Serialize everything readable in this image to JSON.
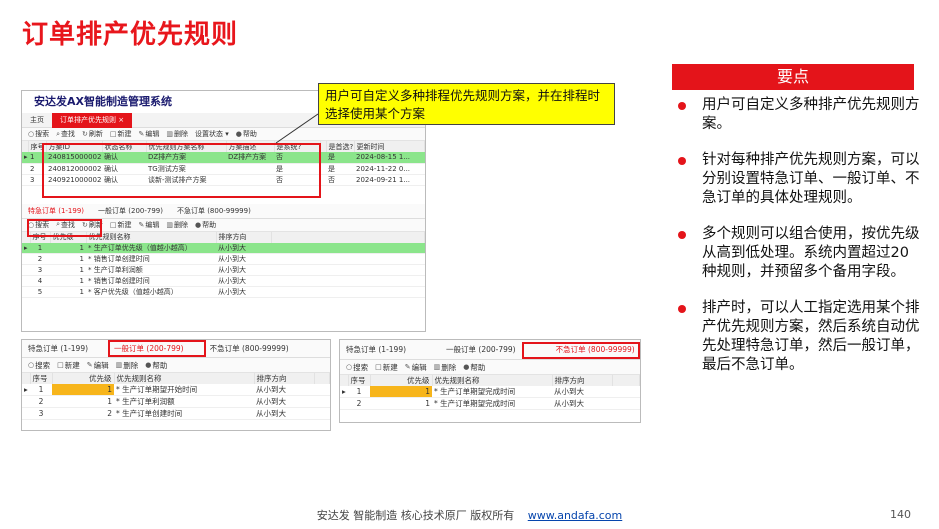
{
  "slide": {
    "title": "订单排产优先规则",
    "key_points_header": "要点",
    "key_points": [
      "用户可自定义多种排产优先规则方案。",
      "针对每种排产优先规则方案，可以分别设置特急订单、一般订单、不急订单的具体处理规则。",
      "多个规则可以组合使用，按优先级从高到低处理。系统内置超过20种规则，并预留多个备用字段。",
      "排产时，可以人工指定选用某个排产优先规则方案，然后系统自动优先处理特急订单，然后一般订单，最后不急订单。"
    ],
    "callout": "用户可自定义多种排程优先规则方案，并在排程时选择使用某个方案",
    "footer_text": "安达发  智能制造 核心技术原厂   版权所有",
    "footer_link": "www.andafa.com",
    "page_number": "140",
    "accent_color": "#e4141a"
  },
  "app": {
    "title": "安达发AX智能制造管理系统",
    "tabs": [
      "主页",
      "订单排产优先规则 ×"
    ],
    "toolbar": [
      "搜索",
      "查找",
      "刷新",
      "新建",
      "编辑",
      "删除",
      "设置状态 ▾",
      "帮助"
    ],
    "scheme_columns": [
      "序号",
      "方案ID",
      "状态名称",
      "优先规则方案名称",
      "方案描述",
      "是系统?",
      "",
      "是首选?",
      "更新时间"
    ],
    "scheme_rows": [
      {
        "no": "1",
        "id": "240815000002...",
        "status": "确认",
        "name": "DZ排产方案",
        "desc": "DZ排产方案",
        "system": "否",
        "pref": "是",
        "time": "2024-08-15 1..."
      },
      {
        "no": "2",
        "id": "240812000002...",
        "status": "确认",
        "name": "TG测试方案",
        "desc": "",
        "system": "是",
        "pref": "是",
        "time": "2024-11-22 0..."
      },
      {
        "no": "3",
        "id": "240921000002...",
        "status": "确认",
        "name": "谈新-测试排产方案",
        "desc": "",
        "system": "否",
        "pref": "否",
        "time": "2024-09-21 1..."
      }
    ],
    "sub_tabs": [
      "特急订单 (1-199)",
      "一般订单 (200-799)",
      "不急订单 (800-99999)"
    ],
    "sub_toolbar": [
      "搜索",
      "查找",
      "刷新",
      "新建",
      "编辑",
      "删除",
      "帮助"
    ],
    "rule_columns": [
      "序号",
      "优先级",
      "优先规则名称",
      "排序方向"
    ],
    "urgent_rules": [
      {
        "no": "1",
        "pri": "1",
        "name": "* 生产订单优先级（值越小越高）",
        "dir": "从小到大"
      },
      {
        "no": "2",
        "pri": "1",
        "name": "* 销售订单创建时间",
        "dir": "从小到大"
      },
      {
        "no": "3",
        "pri": "1",
        "name": "* 生产订单利润额",
        "dir": "从小到大"
      },
      {
        "no": "4",
        "pri": "1",
        "name": "* 销售订单创建时间",
        "dir": "从小到大"
      },
      {
        "no": "5",
        "pri": "1",
        "name": "* 客户优先级（值越小越高）",
        "dir": "从小到大"
      }
    ]
  },
  "normal_window": {
    "tabs": [
      "特急订单 (1-199)",
      "一般订单 (200-799)",
      "不急订单 (800-99999)"
    ],
    "toolbar": [
      "搜索",
      "新建",
      "编辑",
      "删除",
      "帮助"
    ],
    "columns": [
      "序号",
      "优先级",
      "优先规则名称",
      "排序方向"
    ],
    "rows": [
      {
        "no": "1",
        "pri": "1",
        "name": "* 生产订单期望开始时间",
        "dir": "从小到大"
      },
      {
        "no": "2",
        "pri": "1",
        "name": "* 生产订单利润额",
        "dir": "从小到大"
      },
      {
        "no": "3",
        "pri": "2",
        "name": "* 生产订单创建时间",
        "dir": "从小到大"
      }
    ]
  },
  "not_urgent_window": {
    "tabs": [
      "特急订单 (1-199)",
      "一般订单 (200-799)",
      "不急订单 (800-99999)"
    ],
    "toolbar": [
      "搜索",
      "新建",
      "编辑",
      "删除",
      "帮助"
    ],
    "columns": [
      "序号",
      "优先级",
      "优先规则名称",
      "排序方向"
    ],
    "rows": [
      {
        "no": "1",
        "pri": "1",
        "name": "* 生产订单期望完成时间",
        "dir": "从小到大"
      },
      {
        "no": "2",
        "pri": "1",
        "name": "* 生产订单期望完成时间",
        "dir": "从小到大"
      }
    ]
  }
}
